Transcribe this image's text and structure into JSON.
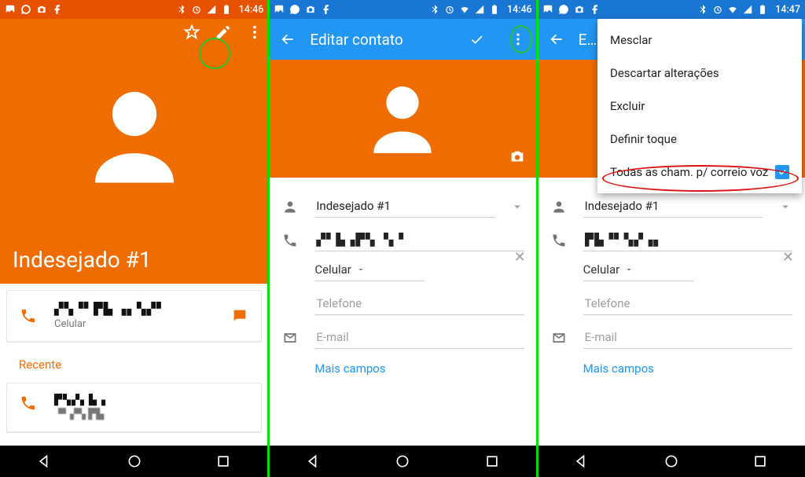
{
  "status": {
    "time_a": "14:46",
    "time_b": "14:46",
    "time_c": "14:47"
  },
  "screen1": {
    "name": "Indesejado #1",
    "phone_masked": "▞▚▝▘▛▙ ▗▖▚▞▘",
    "phone_type": "Celular",
    "recent_label": "Recente",
    "recent_num": "▛▚▞▖▙▗",
    "recent_time": "▝▘▞▚ ▛▙"
  },
  "screen2": {
    "title": "Editar contato",
    "name_field": "Indesejado #1",
    "phone_field": "▞▘▙▗▛▚ ▝▖▘",
    "type": "Celular",
    "phone_placeholder": "Telefone",
    "email_placeholder": "E-mail",
    "more": "Mais campos"
  },
  "screen3": {
    "title_trunc": "E…",
    "menu": {
      "merge": "Mesclar",
      "discard": "Descartar alterações",
      "delete": "Excluir",
      "ringtone": "Definir toque",
      "voicemail": "Todas as cham. p/ correio voz"
    },
    "name_field": "Indesejado #1",
    "phone_field": "▛▙▝▘▚▞▗▖",
    "type": "Celular",
    "phone_placeholder": "Telefone",
    "email_placeholder": "E-mail",
    "more": "Mais campos"
  }
}
